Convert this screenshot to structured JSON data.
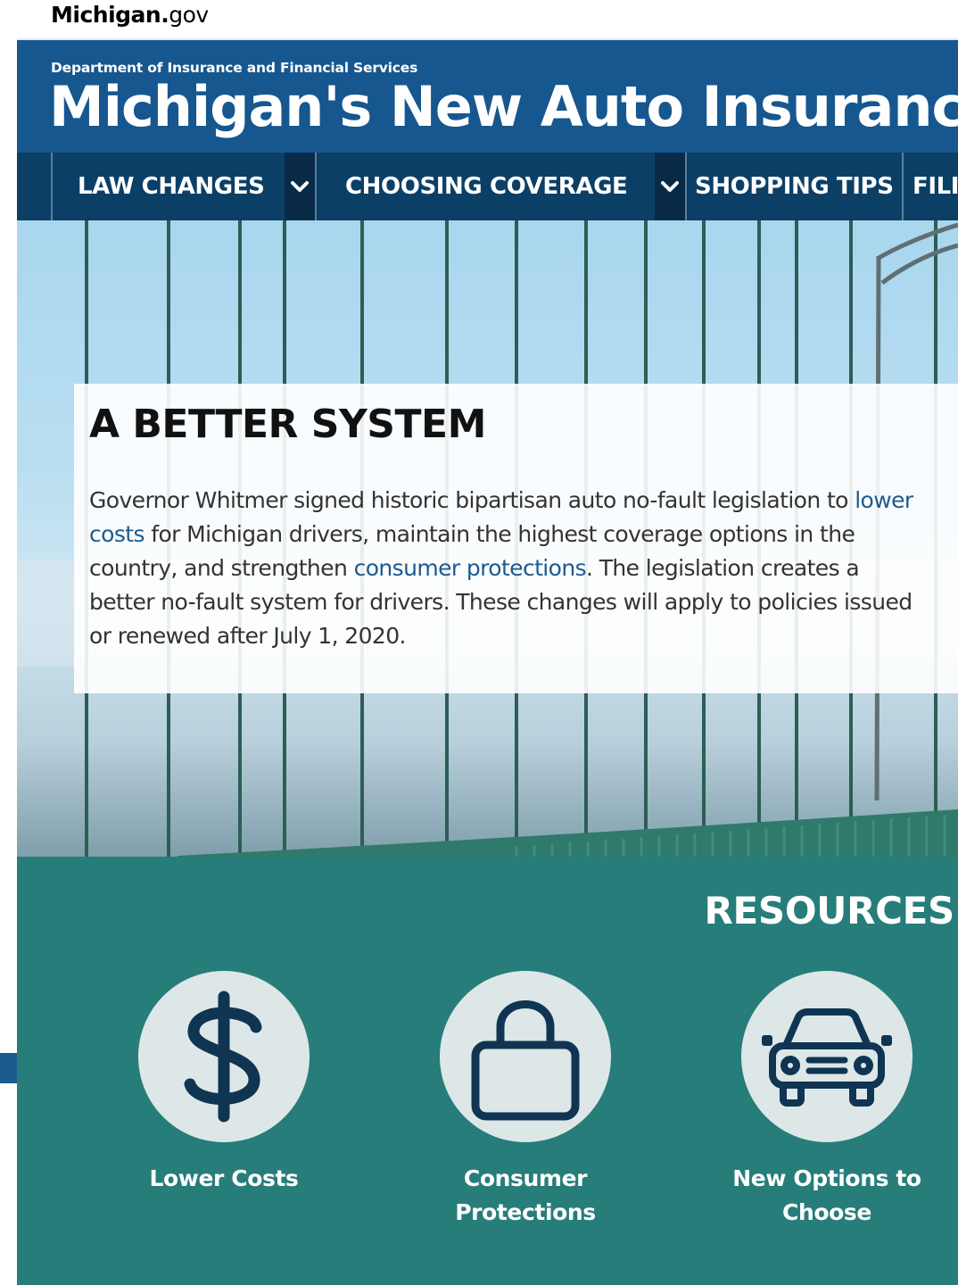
{
  "state_bar": {
    "logo_bold": "Michigan.",
    "logo_light": "gov"
  },
  "header": {
    "department": "Department of Insurance and Financial Services",
    "title": "Michigan's New Auto Insurance"
  },
  "nav": {
    "items": [
      {
        "label": "LAW CHANGES"
      },
      {
        "label": "CHOOSING COVERAGE"
      },
      {
        "label": "SHOPPING TIPS"
      },
      {
        "label": "FILING"
      }
    ]
  },
  "hero": {
    "heading": "A BETTER SYSTEM",
    "text_1": "Governor Whitmer signed historic bipartisan auto no-fault legislation to ",
    "link_1": "lower costs",
    "text_2": " for Michigan drivers, maintain the highest coverage options in the country, and strengthen ",
    "link_2": "consumer protections",
    "text_3": ". The legislation creates a better no-fault system for drivers. These changes will apply to policies issued or renewed after July 1, 2020."
  },
  "resources": {
    "title": "RESOURCES",
    "items": [
      {
        "label": "Lower Costs",
        "icon": "dollar-icon"
      },
      {
        "label": "Consumer Protections",
        "icon": "lock-icon"
      },
      {
        "label": "New Options to Choose",
        "icon": "car-icon"
      }
    ]
  },
  "colors": {
    "header_blue": "#16578f",
    "nav_navy": "#0b3f66",
    "teal": "#277d79",
    "icon_navy": "#0f3552",
    "link_blue": "#1d5a8f"
  }
}
